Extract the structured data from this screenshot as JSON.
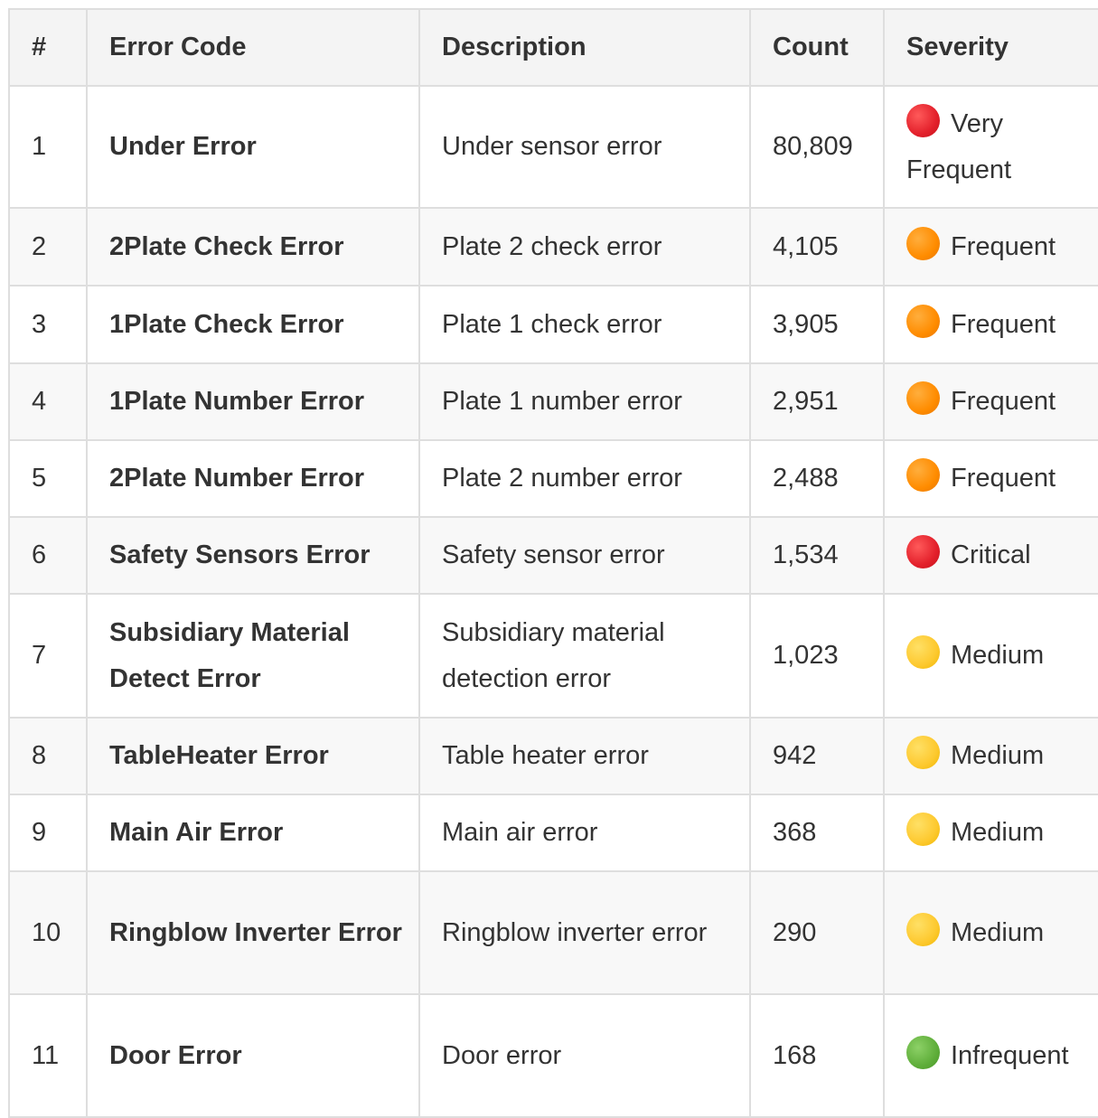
{
  "table": {
    "headers": [
      "#",
      "Error Code",
      "Description",
      "Count",
      "Severity"
    ],
    "rows": [
      {
        "num": "1",
        "code": "Under Error",
        "desc": "Under sensor error",
        "count": "80,809",
        "severity": "Very Frequent",
        "color": "#e3202b",
        "icon": "red-circle-icon"
      },
      {
        "num": "2",
        "code": "2Plate Check Error",
        "desc": "Plate 2 check error",
        "count": "4,105",
        "severity": "Frequent",
        "color": "#ff8c00",
        "icon": "orange-circle-icon"
      },
      {
        "num": "3",
        "code": "1Plate Check Error",
        "desc": "Plate 1 check error",
        "count": "3,905",
        "severity": "Frequent",
        "color": "#ff8c00",
        "icon": "orange-circle-icon"
      },
      {
        "num": "4",
        "code": "1Plate Number Error",
        "desc": "Plate 1 number error",
        "count": "2,951",
        "severity": "Frequent",
        "color": "#ff8c00",
        "icon": "orange-circle-icon"
      },
      {
        "num": "5",
        "code": "2Plate Number Error",
        "desc": "Plate 2 number error",
        "count": "2,488",
        "severity": "Frequent",
        "color": "#ff8c00",
        "icon": "orange-circle-icon"
      },
      {
        "num": "6",
        "code": "Safety Sensors Error",
        "desc": "Safety sensor error",
        "count": "1,534",
        "severity": "Critical",
        "color": "#e3202b",
        "icon": "red-circle-icon"
      },
      {
        "num": "7",
        "code": "Subsidiary Material Detect Error",
        "desc": "Subsidiary material detection error",
        "count": "1,023",
        "severity": "Medium",
        "color": "#fdc92f",
        "icon": "yellow-circle-icon"
      },
      {
        "num": "8",
        "code": "TableHeater Error",
        "desc": "Table heater error",
        "count": "942",
        "severity": "Medium",
        "color": "#fdc92f",
        "icon": "yellow-circle-icon"
      },
      {
        "num": "9",
        "code": "Main Air Error",
        "desc": "Main air error",
        "count": "368",
        "severity": "Medium",
        "color": "#fdc92f",
        "icon": "yellow-circle-icon"
      },
      {
        "num": "10",
        "code": "Ringblow Inverter Error",
        "desc": "Ringblow inverter error",
        "count": "290",
        "severity": "Medium",
        "color": "#fdc92f",
        "icon": "yellow-circle-icon"
      },
      {
        "num": "11",
        "code": "Door Error",
        "desc": "Door error",
        "count": "168",
        "severity": "Infrequent",
        "color": "#5fae3a",
        "icon": "green-circle-icon"
      }
    ]
  }
}
